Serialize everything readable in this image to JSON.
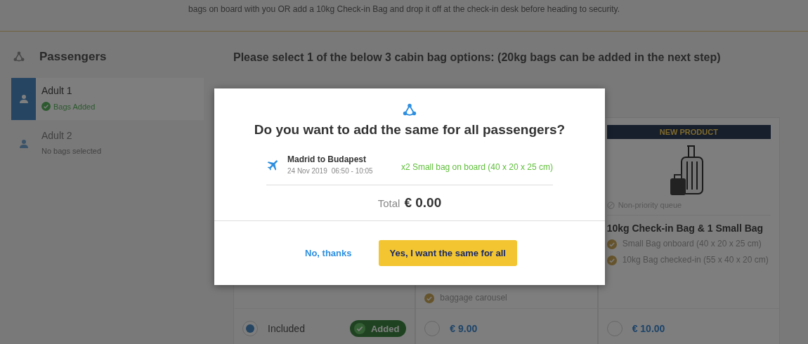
{
  "intro": {
    "text": "bags on board with you OR add a 10kg Check-in Bag and drop it off at the check-in desk before heading to security."
  },
  "sidebar": {
    "title": "Passengers",
    "passengers": [
      {
        "name": "Adult 1",
        "status": "Bags Added",
        "selected": true,
        "bags_added": true
      },
      {
        "name": "Adult 2",
        "status": "No bags selected",
        "selected": false,
        "bags_added": false
      }
    ]
  },
  "main": {
    "heading": "Please select 1 of the below 3 cabin bag options: (20kg bags can be added in the next step)",
    "options": [
      {
        "kind": "included",
        "selected": true,
        "label": "Included",
        "badge": "Added"
      },
      {
        "kind": "priority",
        "selected": false,
        "features": [
          "baggage carousel"
        ],
        "price": "€ 9.00"
      },
      {
        "kind": "checkin",
        "selected": false,
        "banner": "NEW PRODUCT",
        "note": "Non-priority queue",
        "title": "10kg Check-in Bag & 1 Small Bag",
        "features": [
          "Small Bag onboard (40 x 20 x 25 cm)",
          "10kg Bag checked-in (55 x 40 x 20 cm)"
        ],
        "price": "€ 10.00"
      }
    ]
  },
  "modal": {
    "title": "Do you want to add the same for all passengers?",
    "flight": {
      "route": "Madrid to Budapest",
      "date": "24 Nov 2019",
      "time": "06:50 - 10:05",
      "bags": "x2 Small bag on board (40 x 20 x 25 cm)"
    },
    "total_label": "Total",
    "total": "€ 0.00",
    "decline_button": "No, thanks",
    "confirm_button": "Yes, I want the same for all"
  }
}
